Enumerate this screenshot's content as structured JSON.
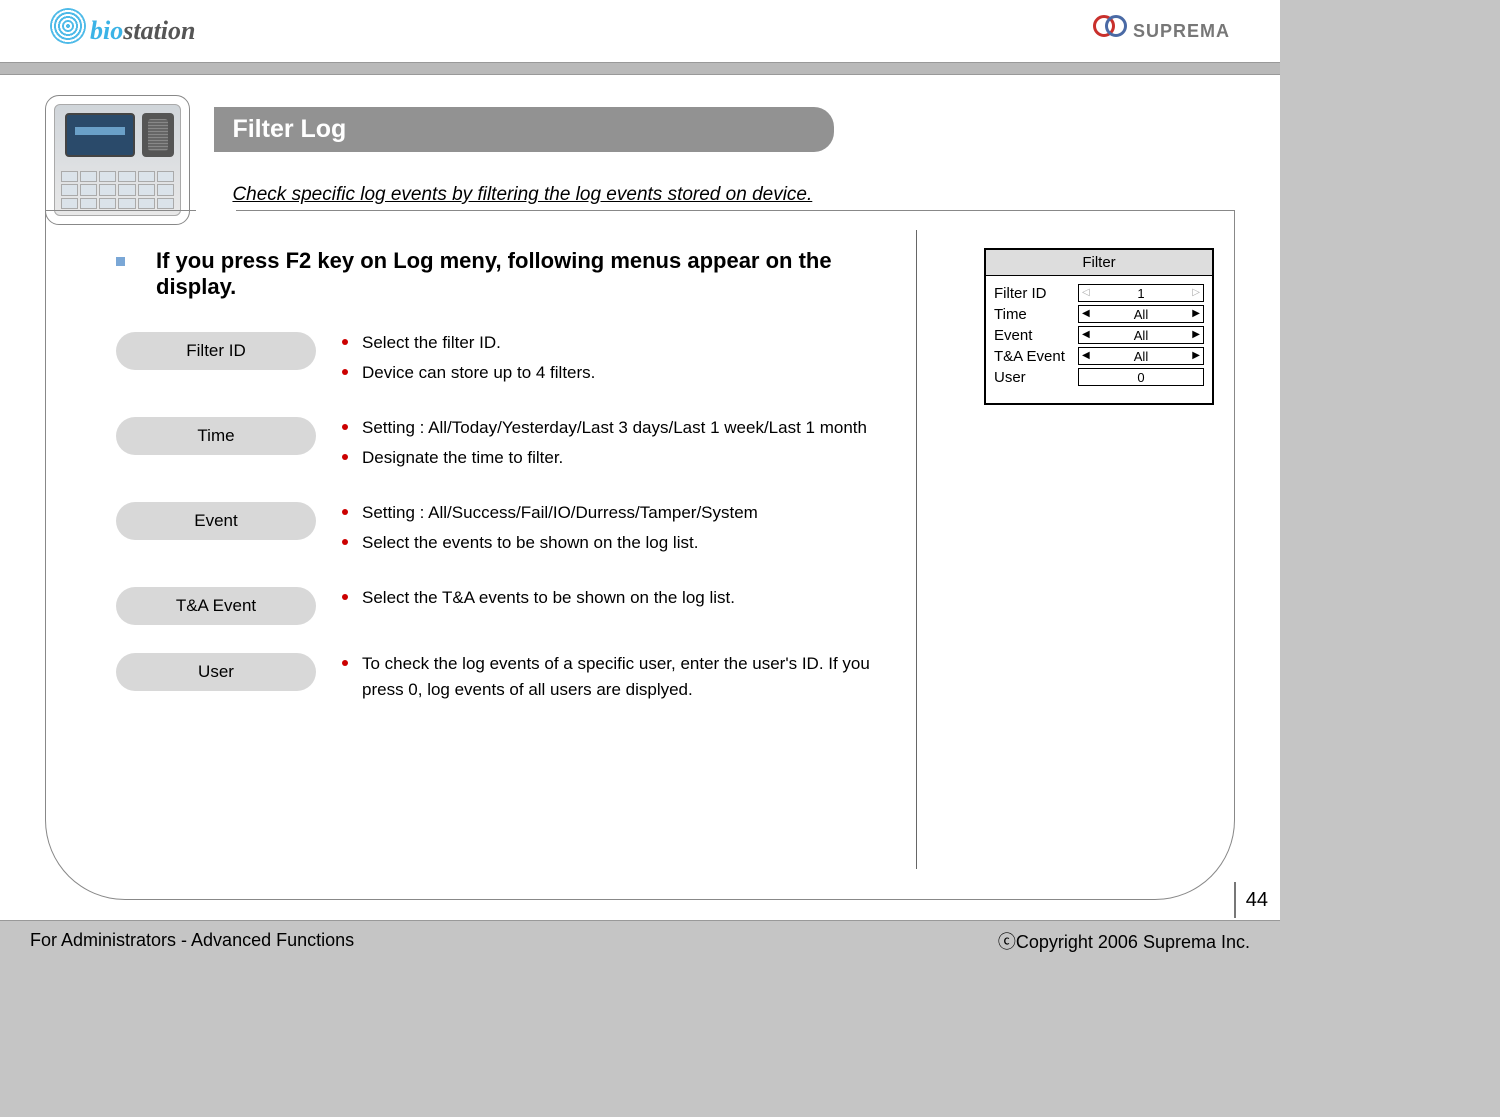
{
  "header": {
    "brand_left": "biostation",
    "brand_right": "SUPREMA"
  },
  "title": "Filter Log",
  "subtitle": "Check specific log events by filtering the log events stored on device.",
  "intro": "If you press F2 key on Log meny, following menus appear on the display.",
  "items": [
    {
      "label": "Filter ID",
      "bullets": [
        "Select the filter ID.",
        "Device can store up to 4 filters."
      ]
    },
    {
      "label": "Time",
      "bullets": [
        "Setting : All/Today/Yesterday/Last 3 days/Last 1 week/Last 1 month",
        "Designate the time to filter."
      ]
    },
    {
      "label": "Event",
      "bullets": [
        "Setting : All/Success/Fail/IO/Durress/Tamper/System",
        "Select the events to be shown on the log list."
      ]
    },
    {
      "label": "T&A Event",
      "bullets": [
        "Select the T&A events to be shown on the log list."
      ]
    },
    {
      "label": "User",
      "bullets": [
        "To check the log events of a specific user, enter the user's ID. If you press 0, log events of all users are displyed."
      ]
    }
  ],
  "filter_panel": {
    "title": "Filter",
    "rows": [
      {
        "label": "Filter ID",
        "value": "1",
        "dim": true
      },
      {
        "label": "Time",
        "value": "All",
        "dim": false
      },
      {
        "label": "Event",
        "value": "All",
        "dim": false
      },
      {
        "label": "T&A Event",
        "value": "All",
        "dim": false
      },
      {
        "label": "User",
        "value": "0",
        "noarrow": true
      }
    ]
  },
  "page_number": "44",
  "footer": {
    "left": "For Administrators - Advanced Functions",
    "right": "ⓒCopyright 2006 Suprema Inc."
  }
}
